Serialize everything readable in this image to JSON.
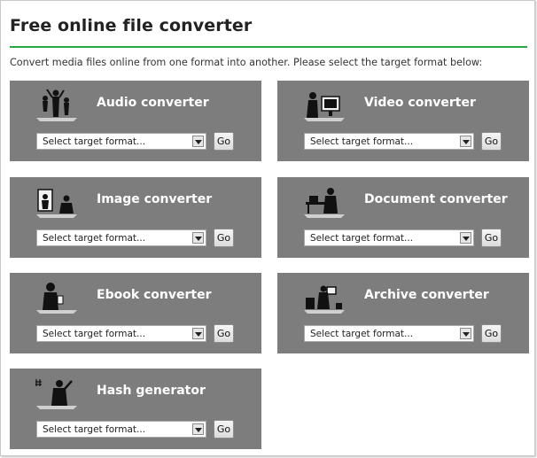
{
  "page": {
    "title": "Free online file converter",
    "intro": "Convert media files online from one format into another. Please select the target format below:",
    "accent_color": "#28a745",
    "card_color": "#7d7d7d"
  },
  "converters": [
    {
      "title": "Audio converter",
      "icon": "audio-people-icon",
      "select_placeholder": "Select target format...",
      "go_label": "Go"
    },
    {
      "title": "Video converter",
      "icon": "video-viewer-icon",
      "select_placeholder": "Select target format...",
      "go_label": "Go"
    },
    {
      "title": "Image converter",
      "icon": "image-camera-icon",
      "select_placeholder": "Select target format...",
      "go_label": "Go"
    },
    {
      "title": "Document converter",
      "icon": "document-desk-icon",
      "select_placeholder": "Select target format...",
      "go_label": "Go"
    },
    {
      "title": "Ebook converter",
      "icon": "ebook-reader-icon",
      "select_placeholder": "Select target format...",
      "go_label": "Go"
    },
    {
      "title": "Archive converter",
      "icon": "archive-boxes-icon",
      "select_placeholder": "Select target format...",
      "go_label": "Go"
    },
    {
      "title": "Hash generator",
      "icon": "hash-person-icon",
      "select_placeholder": "Select target format...",
      "go_label": "Go"
    }
  ]
}
